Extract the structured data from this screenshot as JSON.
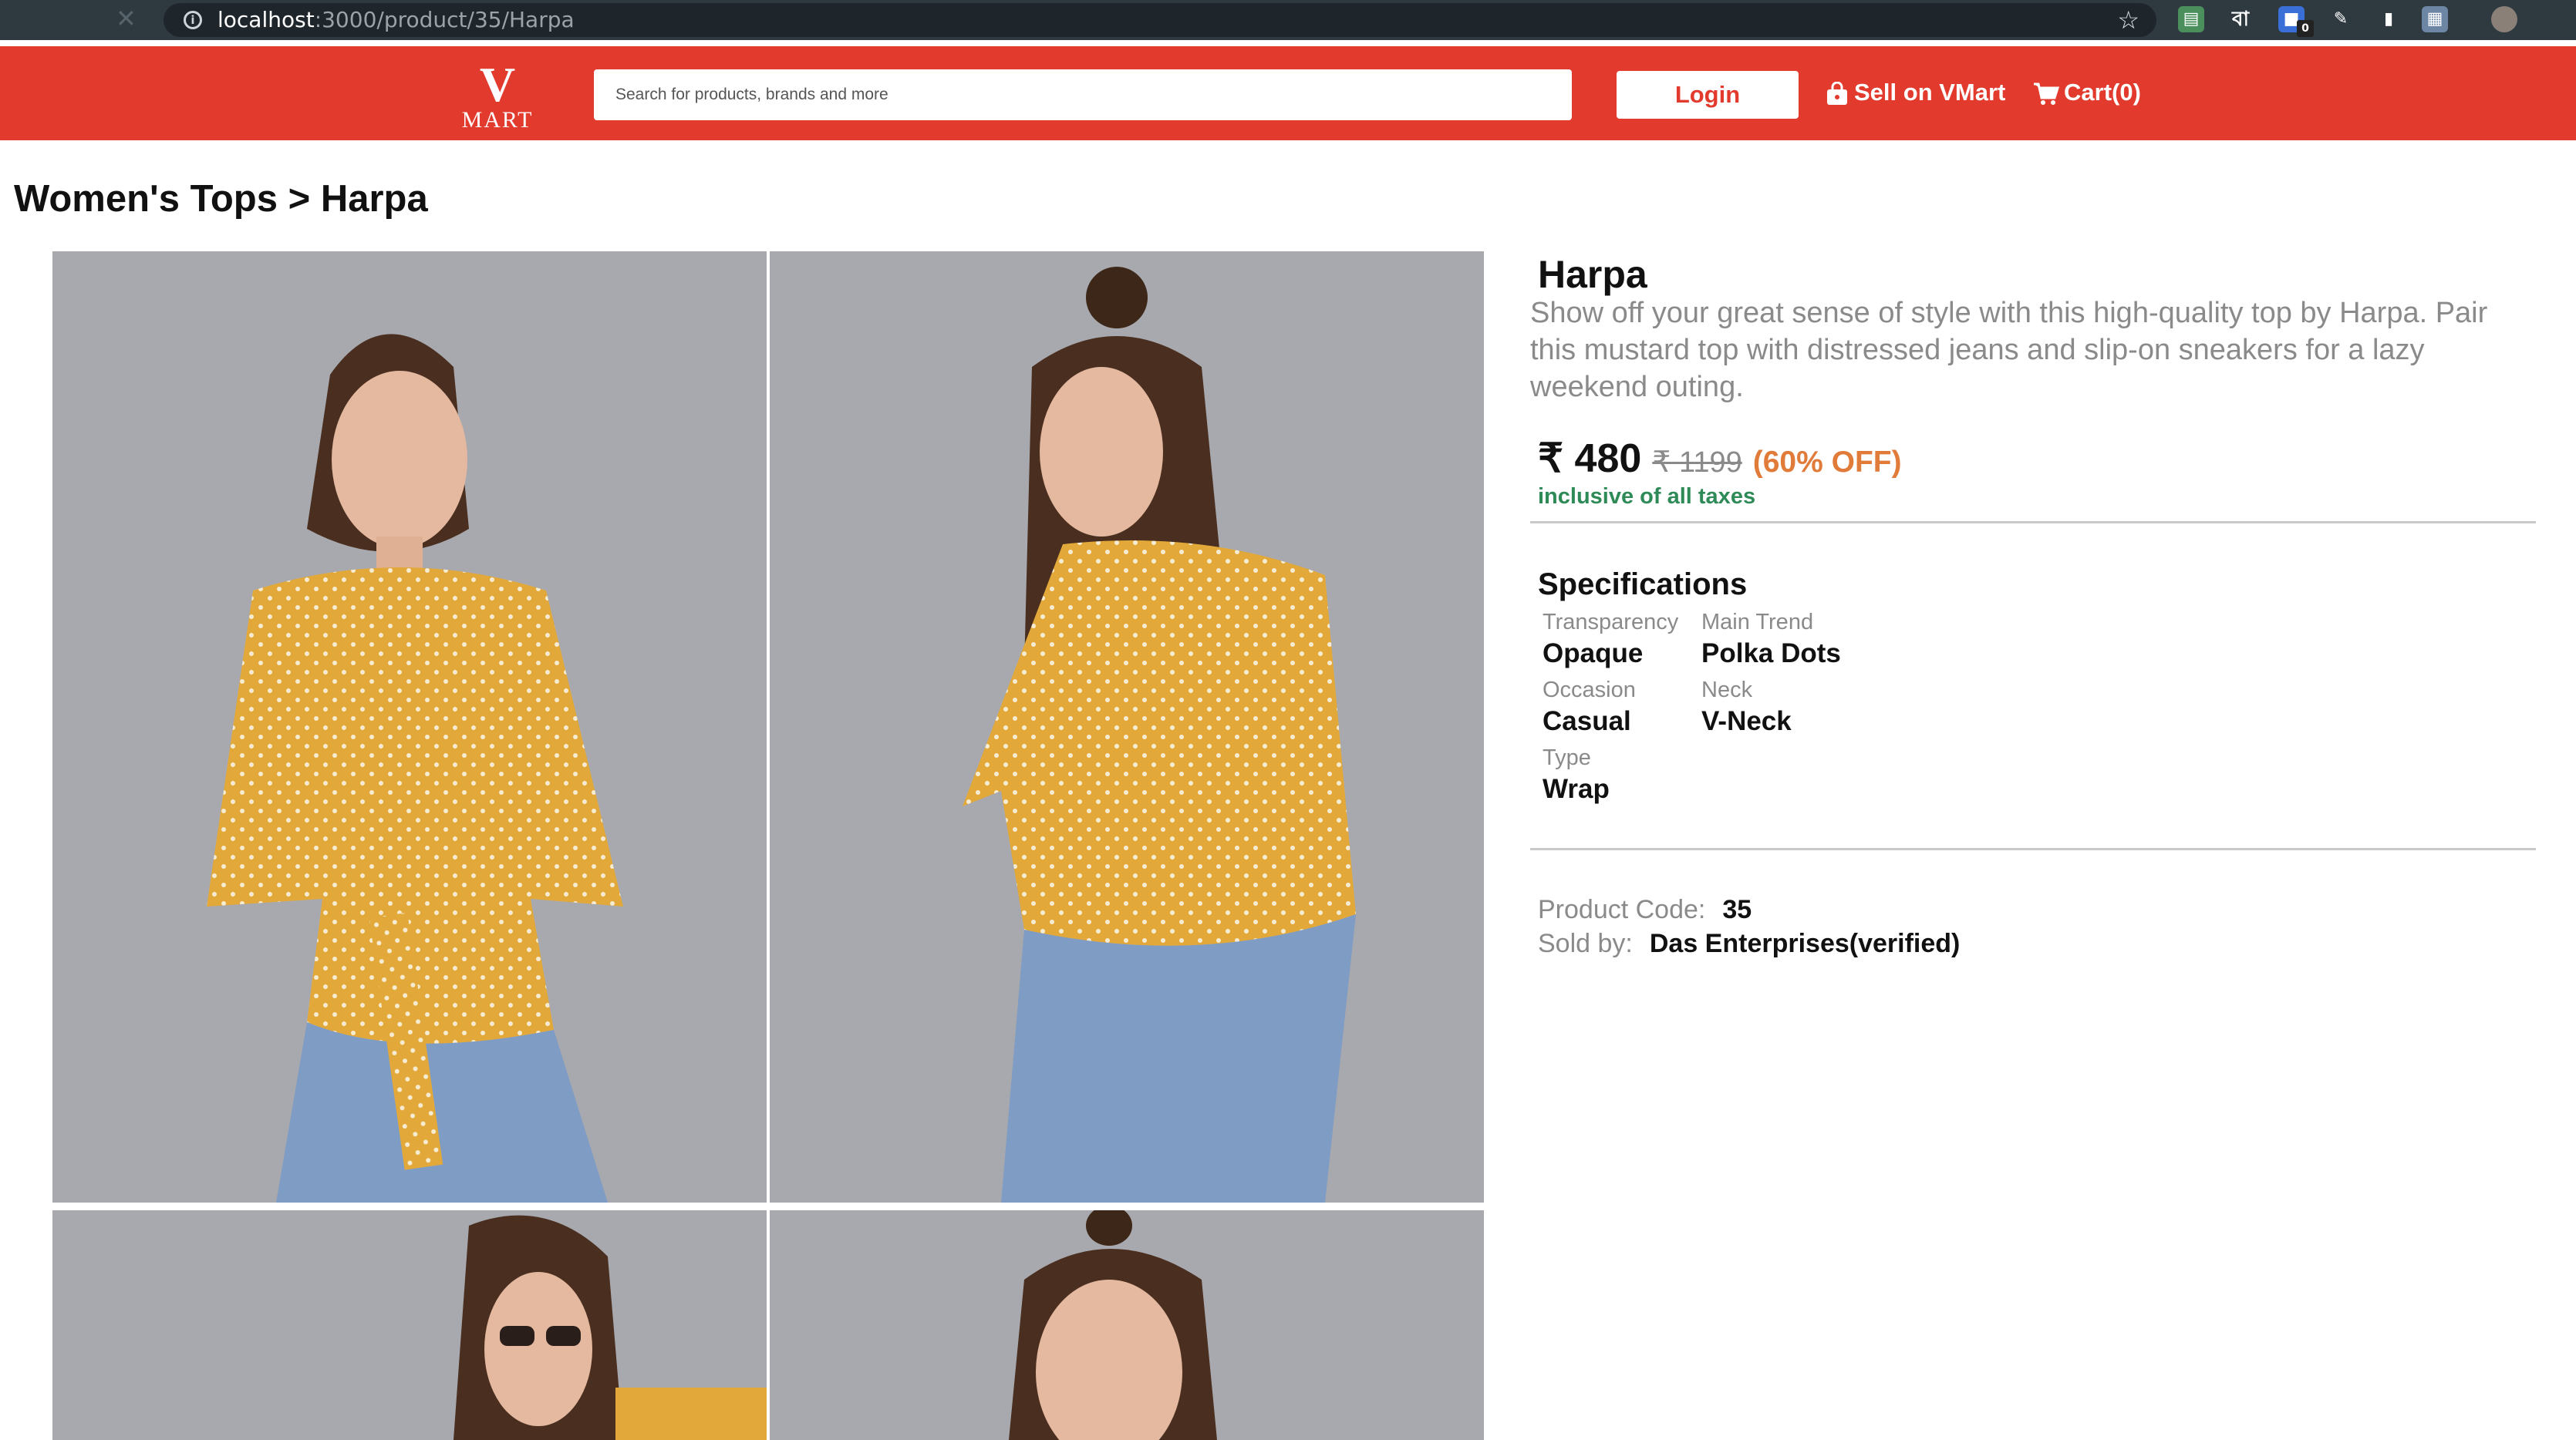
{
  "browser": {
    "url_host": "localhost",
    "url_path": ":3000/product/35/Harpa",
    "extension_badge": "0",
    "bengali_glyph": "বা"
  },
  "header": {
    "logo_letter": "V",
    "logo_text": "MART",
    "search_placeholder": "Search for products, brands and more",
    "login_label": "Login",
    "sell_label": "Sell on VMart",
    "cart_label": "Cart(0)",
    "brand_color": "#e23a2d"
  },
  "breadcrumb": "Women's Tops > Harpa",
  "product": {
    "title": "Harpa",
    "description": " Show off your great sense of style with this high-quality top by Harpa. Pair this mustard top with distressed jeans and slip-on sneakers for a lazy weekend outing.",
    "price": "₹ 480",
    "mrp": "₹ 1199",
    "discount": "(60% OFF)",
    "taxes_note": "inclusive of all taxes"
  },
  "specifications": {
    "title": "Specifications",
    "items": [
      {
        "key": "Transparency",
        "value": "Opaque"
      },
      {
        "key": "Main Trend",
        "value": "Polka Dots"
      },
      {
        "key": "Occasion",
        "value": "Casual"
      },
      {
        "key": "Neck",
        "value": "V-Neck"
      },
      {
        "key": "Type",
        "value": "Wrap"
      }
    ]
  },
  "meta": {
    "product_code_label": "Product Code:",
    "product_code": "35",
    "sold_by_label": "Sold by:",
    "sold_by": "Das Enterprises(verified)"
  },
  "photos": [
    {
      "name": "front-view"
    },
    {
      "name": "back-view"
    },
    {
      "name": "sunglasses-pose"
    },
    {
      "name": "close-up"
    }
  ]
}
